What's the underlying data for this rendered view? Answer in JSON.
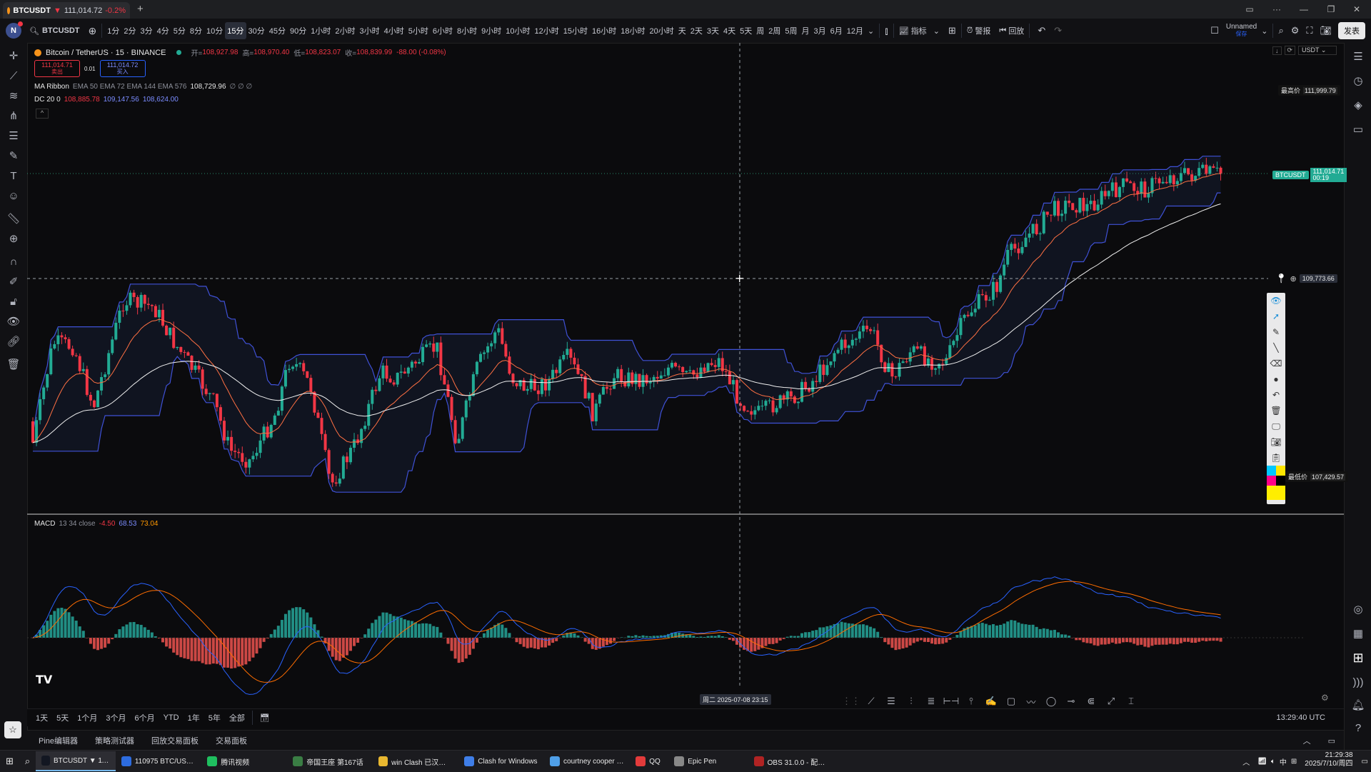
{
  "browser": {
    "tab_symbol": "BTCUSDT",
    "tab_change_arrow": "▼",
    "tab_price": "111,014.72",
    "tab_change": "-0.2%",
    "new_tab": "+"
  },
  "toolbar": {
    "avatar_letter": "N",
    "symbol": "BTCUSDT",
    "intervals": [
      "1分",
      "2分",
      "3分",
      "4分",
      "5分",
      "8分",
      "10分",
      "15分",
      "30分",
      "45分",
      "90分",
      "1小时",
      "2小时",
      "3小时",
      "4小时",
      "5小时",
      "6小时",
      "8小时",
      "9小时",
      "10小时",
      "12小时",
      "15小时",
      "16小时",
      "18小时",
      "20小时",
      "天",
      "2天",
      "3天",
      "4天",
      "5天",
      "周",
      "2周",
      "5周",
      "月",
      "3月",
      "6月",
      "12月"
    ],
    "active_interval": "15分",
    "indicators_label": "指标",
    "alert_label": "警报",
    "replay_label": "回放",
    "layout_name": "Unnamed",
    "layout_sub": "保存",
    "publish_label": "发表"
  },
  "legend": {
    "title": "Bitcoin / TetherUS · 15 · BINANCE",
    "open_label": "开=",
    "open": "108,927.98",
    "high_label": "高=",
    "high": "108,970.40",
    "low_label": "低=",
    "low": "108,823.07",
    "close_label": "收=",
    "close": "108,839.99",
    "change": "-88.00 (-0.08%)",
    "sell_price": "111,014.71",
    "sell_label": "卖出",
    "spread": "0.01",
    "buy_price": "111,014.72",
    "buy_label": "买入",
    "ma_ribbon_name": "MA Ribbon",
    "ma_ribbon_params": "EMA 50 EMA 72 EMA 144 EMA 576",
    "ma_ribbon_value": "108,729.96",
    "ma_ribbon_rest": "∅ ∅ ∅",
    "dc_name": "DC 20 0",
    "dc_upper": "108,885.78",
    "dc_middle": "109,147.56",
    "dc_lower": "108,624.00",
    "collapse": "^"
  },
  "price_axis": {
    "currency": "USDT",
    "high_label": "最高价",
    "high_value": "111,999.79",
    "symbol_tag": "BTCUSDT",
    "last_price": "111,014.71",
    "countdown": "00:19",
    "crosshair_price": "109,773.66",
    "low_label": "最低价",
    "low_value": "107,429.57"
  },
  "macd": {
    "name": "MACD",
    "params": "13 34 close",
    "hist": "-4.50",
    "macd": "68.53",
    "signal": "73.04"
  },
  "time_axis": {
    "crosshair_time": "周二 2025-07-08   23:15",
    "clock": "13:29:40 UTC"
  },
  "ranges": [
    "1天",
    "5天",
    "1个月",
    "3个月",
    "6个月",
    "YTD",
    "1年",
    "5年",
    "全部"
  ],
  "panels": [
    "Pine编辑器",
    "策略测试器",
    "回放交易面板",
    "交易面板"
  ],
  "taskbar": {
    "items": [
      {
        "label": "BTCUSDT ▼ 111,0...",
        "color": "#131722"
      },
      {
        "label": "110975 BTC/USD...",
        "color": "#2d6cdf"
      },
      {
        "label": "腾讯视频",
        "color": "#1fbf5f"
      },
      {
        "label": "帝国王座 第167话",
        "color": "#3a7d44"
      },
      {
        "label": "win Clash 已汉化 0...",
        "color": "#e8b730"
      },
      {
        "label": "Clash for Windows",
        "color": "#3f7ee8"
      },
      {
        "label": "courtney cooper -...",
        "color": "#4f9fe8"
      },
      {
        "label": "QQ",
        "color": "#e33b3b"
      },
      {
        "label": "Epic Pen",
        "color": "#888888"
      },
      {
        "label": "OBS 31.0.0 - 配置...",
        "color": "#b02323"
      }
    ],
    "ime": "中",
    "time": "21:29:38",
    "date": "2025/7/10/周四"
  },
  "colors": {
    "up": "#22ab94",
    "down": "#f23645",
    "donchian": "#3f51d6",
    "macd_line": "#2962ff",
    "signal_line": "#ff6d00"
  },
  "chart_data": {
    "type": "candlestick",
    "symbol": "BTCUSDT",
    "price_range": [
      107429.57,
      111999.79
    ],
    "overlays": [
      "MA Ribbon EMA 50/72/144/576",
      "Donchian Channel 20"
    ],
    "last_price": 111014.71
  }
}
